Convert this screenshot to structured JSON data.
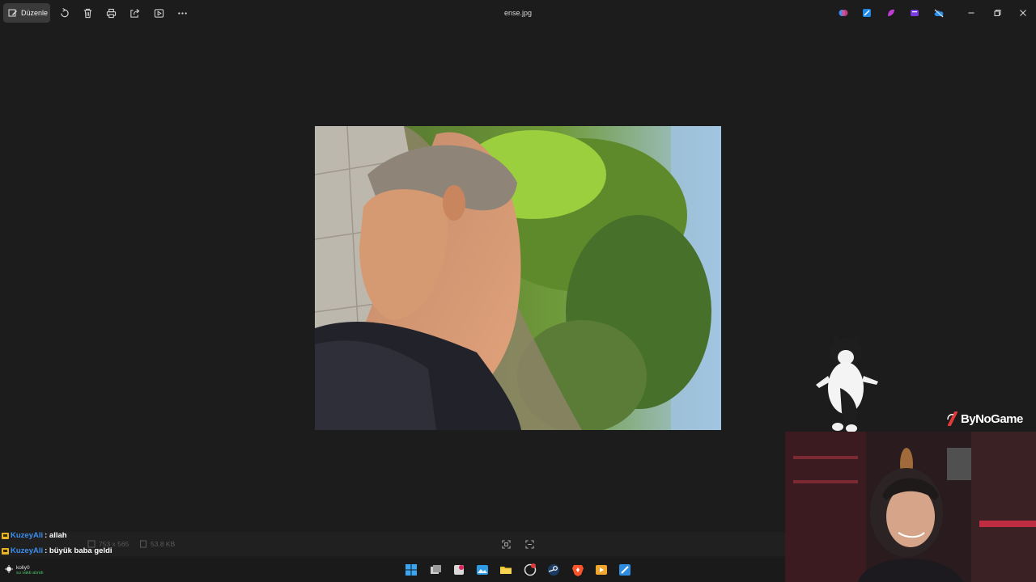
{
  "toolbar": {
    "edit_label": "Düzenle",
    "file_name": "ense.jpg"
  },
  "info": {
    "dimensions": "753 x 565",
    "file_size": "53.8 KB"
  },
  "chat": [
    {
      "user": "KuzeyAli",
      "message": ": allah"
    },
    {
      "user": "KuzeyAli",
      "message": ": büyük baba geldi"
    }
  ],
  "weather": {
    "location": "koliy0",
    "status": "su vakti alındı"
  },
  "overlay": {
    "brand": "ByNoGame"
  },
  "icons": {
    "edit": "edit-icon",
    "rotate": "rotate-icon",
    "delete": "trash-icon",
    "print": "print-icon",
    "share": "share-icon",
    "slideshow": "slideshow-icon",
    "more": "more-icon"
  },
  "colors": {
    "background": "#1c1c1c",
    "chat_user": "#3b8ef0",
    "badge": "#e6b422"
  }
}
